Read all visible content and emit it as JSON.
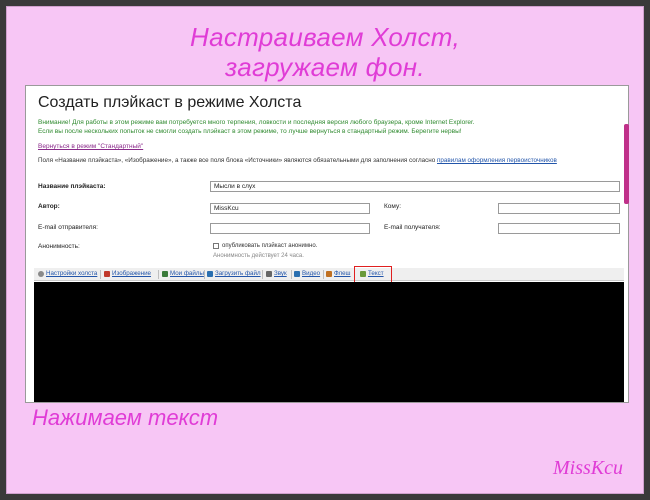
{
  "tutorial": {
    "title_line_1": "Настраиваем Холст,",
    "title_line_2": "загружаем фон.",
    "caption": "Нажимаем текст",
    "signature": "MissKcu"
  },
  "page": {
    "heading": "Создать плэйкаст в режиме Холста",
    "warning_line_1": "Внимание! Для работы в этом режиме вам потребуется много терпения, ловкости и последняя версия любого браузера, кроме Internet Explorer.",
    "warning_line_2": "Если вы после нескольких попыток не смогли создать плэйкаст в этом режиме, то лучше вернуться в стандартный режим. Берегите нервы!",
    "back_link": "Вернуться в режим \"Стандартный\"",
    "required_note": "Поля «Название плэйкаста», «Изображение», а также все поля блока «Источники» являются обязательными для заполнения согласно",
    "required_link": "правилам оформления первоисточников"
  },
  "form": {
    "name_label": "Название плэйкаста:",
    "name_value": "Мысли в слух",
    "author_label": "Автор:",
    "author_value": "MissKcu",
    "to_label": "Кому:",
    "to_value": "",
    "sender_email_label": "E-mail отправителя:",
    "sender_email_value": "",
    "recipient_email_label": "E-mail получателя:",
    "recipient_email_value": "",
    "anonymity_label": "Анонимность:",
    "anonymity_checkbox_label": "опубликовать плэйкаст анонимно.",
    "anonymity_note": "Анонимность действует 24 часа."
  },
  "toolbar": {
    "items": [
      {
        "label": "Настройки холста",
        "icon": "gear-icon",
        "color": "#8a8a8a"
      },
      {
        "label": "Изображение",
        "icon": "image-icon",
        "color": "#c0392b"
      },
      {
        "label": "Мои файлы",
        "icon": "folder-icon",
        "color": "#3a7a3a"
      },
      {
        "label": "Загрузить файл",
        "icon": "upload-icon",
        "color": "#2a6fb0"
      },
      {
        "label": "Звук",
        "icon": "sound-icon",
        "color": "#666666"
      },
      {
        "label": "Видео",
        "icon": "video-icon",
        "color": "#2a6fb0"
      },
      {
        "label": "Флеш",
        "icon": "flash-icon",
        "color": "#c07020"
      },
      {
        "label": "Текст",
        "icon": "text-icon",
        "color": "#6a9a3a"
      }
    ]
  },
  "colors": {
    "accent_pink": "#e03cd6",
    "frame_bg": "#f7c6f5",
    "highlight": "#e02020",
    "link": "#2255aa",
    "warning": "#2f8a2f"
  }
}
